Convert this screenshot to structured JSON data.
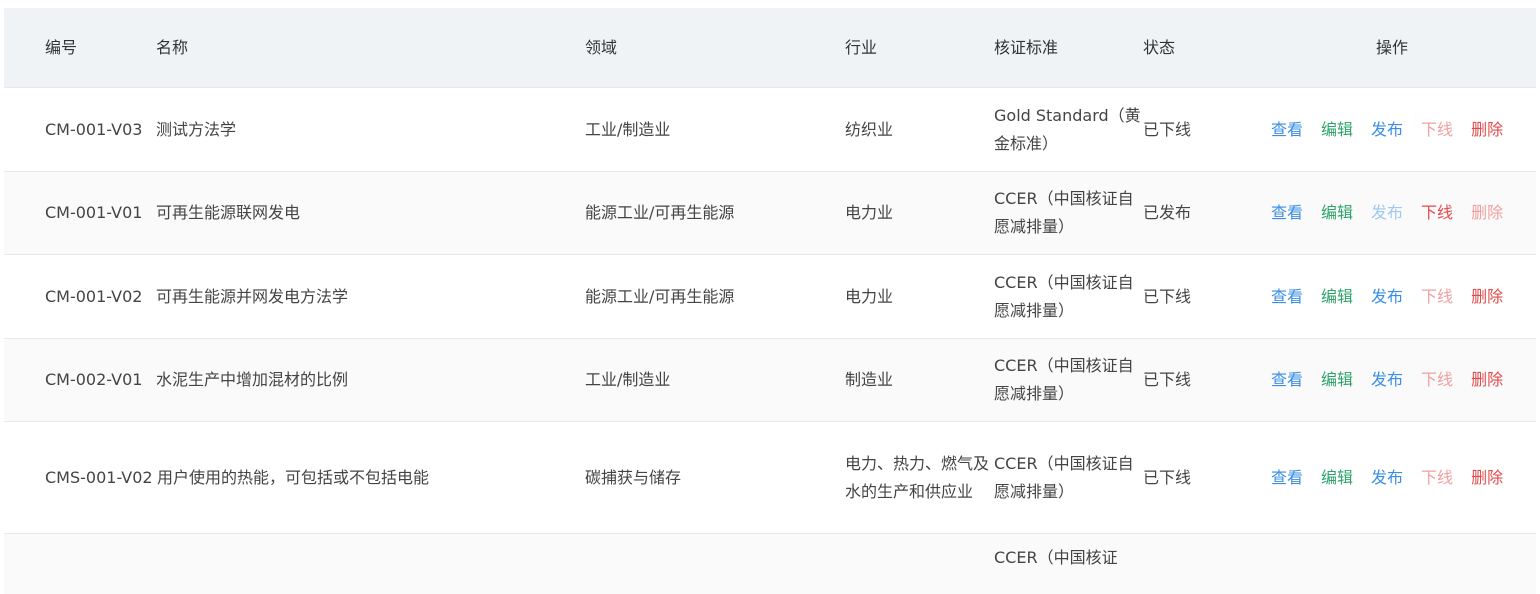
{
  "headers": {
    "code": "编号",
    "name": "名称",
    "domain": "领域",
    "industry": "行业",
    "standard": "核证标准",
    "status": "状态",
    "actions": "操作"
  },
  "action_labels": {
    "view": "查看",
    "edit": "编辑",
    "publish": "发布",
    "offline": "下线",
    "delete": "删除"
  },
  "rows": [
    {
      "code": "CM-001-V03",
      "name": "测试方法学",
      "domain": "工业/制造业",
      "industry": "纺织业",
      "standard": "Gold Standard（黄金标准）",
      "status": "已下线"
    },
    {
      "code": "CM-001-V01",
      "name": "可再生能源联网发电",
      "domain": "能源工业/可再生能源",
      "industry": "电力业",
      "standard": "CCER（中国核证自愿减排量）",
      "status": "已发布"
    },
    {
      "code": "CM-001-V02",
      "name": "可再生能源并网发电方法学",
      "domain": "能源工业/可再生能源",
      "industry": "电力业",
      "standard": "CCER（中国核证自愿减排量）",
      "status": "已下线"
    },
    {
      "code": "CM-002-V01",
      "name": "水泥生产中增加混材的比例",
      "domain": "工业/制造业",
      "industry": "制造业",
      "standard": "CCER（中国核证自愿减排量）",
      "status": "已下线"
    },
    {
      "code": "CMS-001-V02",
      "name": "用户使用的热能，可包括或不包括电能",
      "domain": "碳捕获与储存",
      "industry": "电力、热力、燃气及水的生产和供应业",
      "standard": "CCER（中国核证自愿减排量）",
      "status": "已下线"
    },
    {
      "code": "",
      "name": "",
      "domain": "",
      "industry": "",
      "standard": "CCER（中国核证",
      "status": ""
    }
  ],
  "colors": {
    "header_bg": "#f0f3f6",
    "view": "#3a8ee6",
    "edit": "#2fa36b",
    "publish": "#3a8ee6",
    "offline": "#e24b4b",
    "delete": "#e24b4b"
  }
}
